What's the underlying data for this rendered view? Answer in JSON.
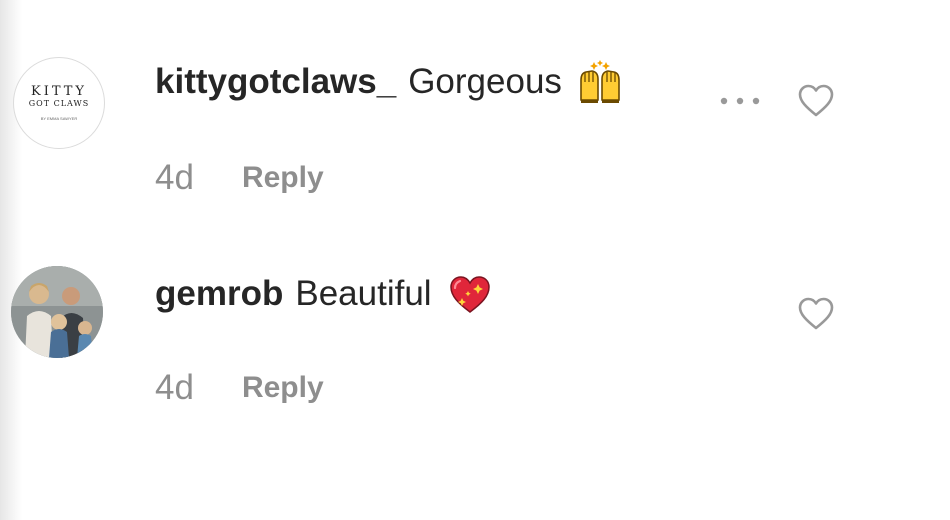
{
  "comments": [
    {
      "avatar": {
        "logo_line1": "KITTY",
        "logo_line2": "GOT CLAWS",
        "logo_line3": "BY EMMA SAWYER"
      },
      "username": "kittygotclaws_",
      "text": "Gorgeous",
      "emoji": "raising-hands-emoji",
      "time": "4d",
      "reply_label": "Reply",
      "icons": {
        "more": "more-options-icon",
        "like": "heart-outline-icon"
      }
    },
    {
      "avatar": {},
      "username": "gemrob",
      "text": "Beautiful",
      "emoji": "sparkling-heart-emoji",
      "time": "4d",
      "reply_label": "Reply",
      "icons": {
        "like": "heart-outline-icon"
      }
    }
  ],
  "colors": {
    "text": "#262626",
    "secondary": "#8e8e8e",
    "icon": "#999999"
  }
}
